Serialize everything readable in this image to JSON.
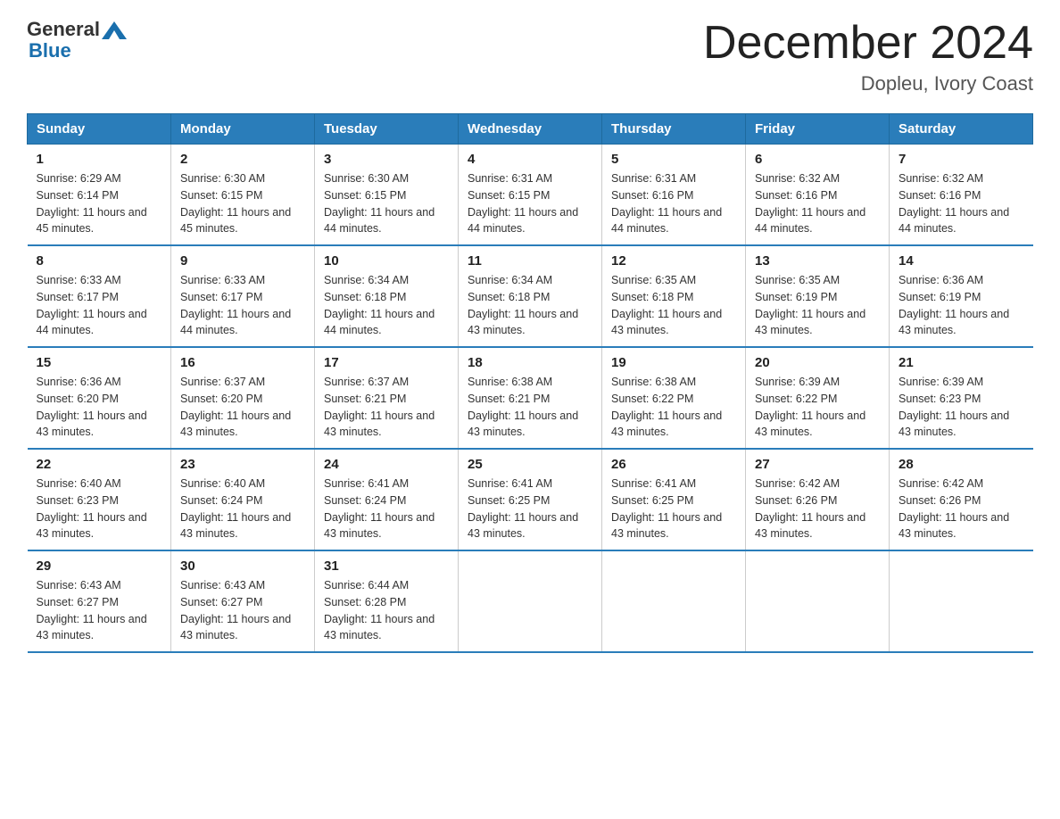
{
  "header": {
    "logo_general": "General",
    "logo_blue": "Blue",
    "title": "December 2024",
    "subtitle": "Dopleu, Ivory Coast"
  },
  "days_of_week": [
    "Sunday",
    "Monday",
    "Tuesday",
    "Wednesday",
    "Thursday",
    "Friday",
    "Saturday"
  ],
  "weeks": [
    [
      {
        "day": "1",
        "sunrise": "6:29 AM",
        "sunset": "6:14 PM",
        "daylight": "11 hours and 45 minutes."
      },
      {
        "day": "2",
        "sunrise": "6:30 AM",
        "sunset": "6:15 PM",
        "daylight": "11 hours and 45 minutes."
      },
      {
        "day": "3",
        "sunrise": "6:30 AM",
        "sunset": "6:15 PM",
        "daylight": "11 hours and 44 minutes."
      },
      {
        "day": "4",
        "sunrise": "6:31 AM",
        "sunset": "6:15 PM",
        "daylight": "11 hours and 44 minutes."
      },
      {
        "day": "5",
        "sunrise": "6:31 AM",
        "sunset": "6:16 PM",
        "daylight": "11 hours and 44 minutes."
      },
      {
        "day": "6",
        "sunrise": "6:32 AM",
        "sunset": "6:16 PM",
        "daylight": "11 hours and 44 minutes."
      },
      {
        "day": "7",
        "sunrise": "6:32 AM",
        "sunset": "6:16 PM",
        "daylight": "11 hours and 44 minutes."
      }
    ],
    [
      {
        "day": "8",
        "sunrise": "6:33 AM",
        "sunset": "6:17 PM",
        "daylight": "11 hours and 44 minutes."
      },
      {
        "day": "9",
        "sunrise": "6:33 AM",
        "sunset": "6:17 PM",
        "daylight": "11 hours and 44 minutes."
      },
      {
        "day": "10",
        "sunrise": "6:34 AM",
        "sunset": "6:18 PM",
        "daylight": "11 hours and 44 minutes."
      },
      {
        "day": "11",
        "sunrise": "6:34 AM",
        "sunset": "6:18 PM",
        "daylight": "11 hours and 43 minutes."
      },
      {
        "day": "12",
        "sunrise": "6:35 AM",
        "sunset": "6:18 PM",
        "daylight": "11 hours and 43 minutes."
      },
      {
        "day": "13",
        "sunrise": "6:35 AM",
        "sunset": "6:19 PM",
        "daylight": "11 hours and 43 minutes."
      },
      {
        "day": "14",
        "sunrise": "6:36 AM",
        "sunset": "6:19 PM",
        "daylight": "11 hours and 43 minutes."
      }
    ],
    [
      {
        "day": "15",
        "sunrise": "6:36 AM",
        "sunset": "6:20 PM",
        "daylight": "11 hours and 43 minutes."
      },
      {
        "day": "16",
        "sunrise": "6:37 AM",
        "sunset": "6:20 PM",
        "daylight": "11 hours and 43 minutes."
      },
      {
        "day": "17",
        "sunrise": "6:37 AM",
        "sunset": "6:21 PM",
        "daylight": "11 hours and 43 minutes."
      },
      {
        "day": "18",
        "sunrise": "6:38 AM",
        "sunset": "6:21 PM",
        "daylight": "11 hours and 43 minutes."
      },
      {
        "day": "19",
        "sunrise": "6:38 AM",
        "sunset": "6:22 PM",
        "daylight": "11 hours and 43 minutes."
      },
      {
        "day": "20",
        "sunrise": "6:39 AM",
        "sunset": "6:22 PM",
        "daylight": "11 hours and 43 minutes."
      },
      {
        "day": "21",
        "sunrise": "6:39 AM",
        "sunset": "6:23 PM",
        "daylight": "11 hours and 43 minutes."
      }
    ],
    [
      {
        "day": "22",
        "sunrise": "6:40 AM",
        "sunset": "6:23 PM",
        "daylight": "11 hours and 43 minutes."
      },
      {
        "day": "23",
        "sunrise": "6:40 AM",
        "sunset": "6:24 PM",
        "daylight": "11 hours and 43 minutes."
      },
      {
        "day": "24",
        "sunrise": "6:41 AM",
        "sunset": "6:24 PM",
        "daylight": "11 hours and 43 minutes."
      },
      {
        "day": "25",
        "sunrise": "6:41 AM",
        "sunset": "6:25 PM",
        "daylight": "11 hours and 43 minutes."
      },
      {
        "day": "26",
        "sunrise": "6:41 AM",
        "sunset": "6:25 PM",
        "daylight": "11 hours and 43 minutes."
      },
      {
        "day": "27",
        "sunrise": "6:42 AM",
        "sunset": "6:26 PM",
        "daylight": "11 hours and 43 minutes."
      },
      {
        "day": "28",
        "sunrise": "6:42 AM",
        "sunset": "6:26 PM",
        "daylight": "11 hours and 43 minutes."
      }
    ],
    [
      {
        "day": "29",
        "sunrise": "6:43 AM",
        "sunset": "6:27 PM",
        "daylight": "11 hours and 43 minutes."
      },
      {
        "day": "30",
        "sunrise": "6:43 AM",
        "sunset": "6:27 PM",
        "daylight": "11 hours and 43 minutes."
      },
      {
        "day": "31",
        "sunrise": "6:44 AM",
        "sunset": "6:28 PM",
        "daylight": "11 hours and 43 minutes."
      },
      null,
      null,
      null,
      null
    ]
  ],
  "labels": {
    "sunrise_prefix": "Sunrise: ",
    "sunset_prefix": "Sunset: ",
    "daylight_prefix": "Daylight: "
  }
}
